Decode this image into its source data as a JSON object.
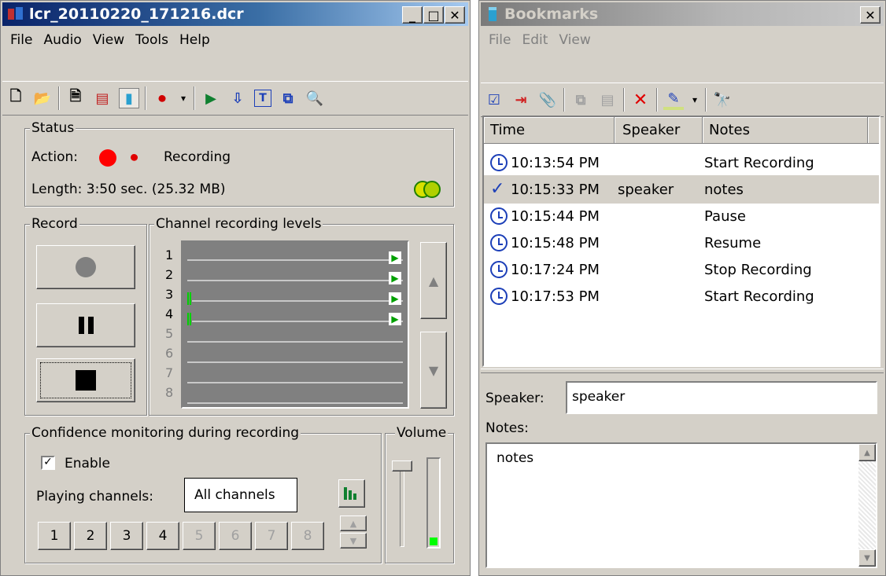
{
  "recorder": {
    "title": "lcr_20110220_171216.dcr",
    "menu": [
      "File",
      "Audio",
      "View",
      "Tools",
      "Help"
    ],
    "status": {
      "group_label": "Status",
      "action_label": "Action:",
      "action_value": "Recording",
      "length_text": "Length: 3:50 sec. (25.32 MB)"
    },
    "record": {
      "group_label": "Record"
    },
    "levels": {
      "group_label": "Channel recording levels",
      "channels": [
        "1",
        "2",
        "3",
        "4",
        "5",
        "6",
        "7",
        "8"
      ]
    },
    "confidence": {
      "group_label": "Confidence monitoring during recording",
      "enable_label": "Enable",
      "enable_checked": true,
      "playing_label": "Playing channels:",
      "playing_value": "All channels",
      "channel_buttons": [
        "1",
        "2",
        "3",
        "4",
        "5",
        "6",
        "7",
        "8"
      ]
    },
    "volume": {
      "group_label": "Volume"
    }
  },
  "bookmarks": {
    "title": "Bookmarks",
    "menu": [
      "File",
      "Edit",
      "View"
    ],
    "columns": [
      "Time",
      "Speaker",
      "Notes"
    ],
    "rows": [
      {
        "time": "10:13:54 PM",
        "speaker": "",
        "notes": "Start Recording",
        "icon": "clock-icon"
      },
      {
        "time": "10:15:33 PM",
        "speaker": "speaker",
        "notes": "notes",
        "icon": "check-icon"
      },
      {
        "time": "10:15:44 PM",
        "speaker": "",
        "notes": "Pause",
        "icon": "clock-icon"
      },
      {
        "time": "10:15:48 PM",
        "speaker": "",
        "notes": "Resume",
        "icon": "clock-icon"
      },
      {
        "time": "10:17:24 PM",
        "speaker": "",
        "notes": "Stop Recording",
        "icon": "clock-icon"
      },
      {
        "time": "10:17:53 PM",
        "speaker": "",
        "notes": "Start Recording",
        "icon": "clock-icon"
      }
    ],
    "speaker_label": "Speaker:",
    "speaker_value": "speaker",
    "notes_label": "Notes:",
    "notes_value": "notes"
  },
  "colors": {
    "title_active": "#0a246a",
    "record_red": "#ff0000",
    "level_green": "#00c000"
  }
}
